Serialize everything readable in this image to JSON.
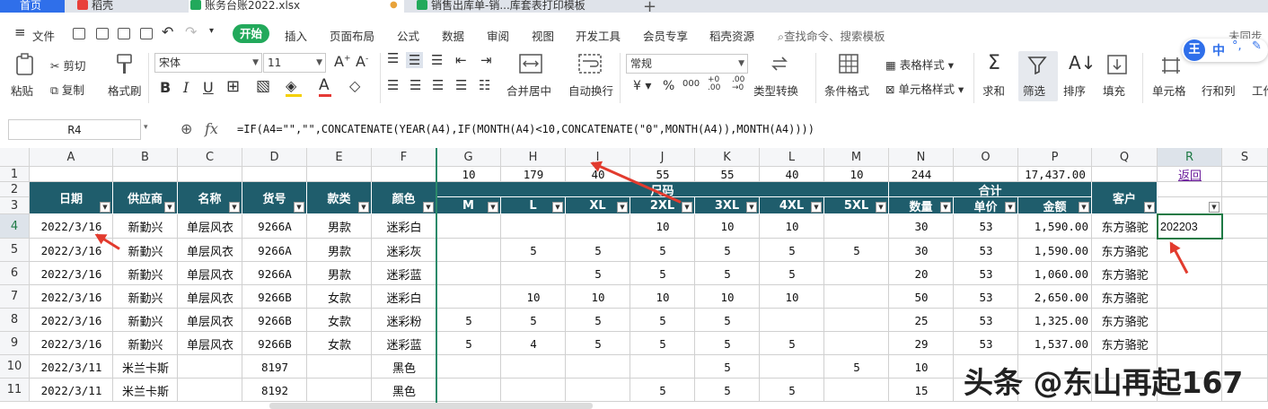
{
  "tabs": [
    {
      "label": "首页"
    },
    {
      "label": "稻壳"
    },
    {
      "label": "账务台账2022.xlsx"
    },
    {
      "label": "销售出库单-销...库套表打印模板"
    }
  ],
  "menu": {
    "file": "文件",
    "items": [
      "开始",
      "插入",
      "页面布局",
      "公式",
      "数据",
      "审阅",
      "视图",
      "开发工具",
      "会员专享",
      "稻壳资源"
    ],
    "search": "查找命令、搜索模板",
    "sync": "未同步"
  },
  "ribbon": {
    "paste": "粘贴",
    "cut": "剪切",
    "copy": "复制",
    "format_painter": "格式刷",
    "font_name": "宋体",
    "font_size": "11",
    "merge": "合并居中",
    "wrap": "自动换行",
    "number_format": "常规",
    "type_convert": "类型转换",
    "cond_format": "条件格式",
    "table_style": "表格样式",
    "cell_style": "单元格样式",
    "sum": "求和",
    "filter": "筛选",
    "sort": "排序",
    "fill": "填充",
    "cells": "单元格",
    "rows_cols": "行和列",
    "work": "工作"
  },
  "formula_bar": {
    "name_box": "R4",
    "fx": "fx",
    "formula": "=IF(A4=\"\",\"\",CONCATENATE(YEAR(A4),IF(MONTH(A4)<10,CONCATENATE(\"0\",MONTH(A4)),MONTH(A4))))"
  },
  "columns": [
    "A",
    "B",
    "C",
    "D",
    "E",
    "F",
    "G",
    "H",
    "I",
    "J",
    "K",
    "L",
    "M",
    "N",
    "O",
    "P",
    "Q",
    "R",
    "S"
  ],
  "row_numbers": [
    "1",
    "2",
    "3",
    "4",
    "5",
    "6",
    "7",
    "8",
    "9",
    "10",
    "11"
  ],
  "row1": {
    "G": "10",
    "H": "179",
    "I": "40",
    "J": "55",
    "K": "55",
    "L": "40",
    "M": "10",
    "N": "244",
    "P": "17,437.00",
    "R": "返回"
  },
  "headers": {
    "date": "日期",
    "supplier": "供应商",
    "name": "名称",
    "code": "货号",
    "style": "款类",
    "color": "颜色",
    "size_group": "尺码",
    "total_group": "合计",
    "customer": "客户",
    "sizes": [
      "M",
      "L",
      "XL",
      "2XL",
      "3XL",
      "4XL",
      "5XL"
    ],
    "qty": "数量",
    "price": "单价",
    "amount": "金额"
  },
  "rows": [
    {
      "A": "2022/3/16",
      "B": "新勤兴",
      "C": "单层风衣",
      "D": "9266A",
      "E": "男款",
      "F": "迷彩白",
      "G": "",
      "H": "",
      "I": "",
      "J": "10",
      "K": "10",
      "L": "10",
      "M": "",
      "N": "30",
      "O": "53",
      "P": "1,590.00",
      "Q": "东方骆驼",
      "R": "202203"
    },
    {
      "A": "2022/3/16",
      "B": "新勤兴",
      "C": "单层风衣",
      "D": "9266A",
      "E": "男款",
      "F": "迷彩灰",
      "G": "",
      "H": "5",
      "I": "5",
      "J": "5",
      "K": "5",
      "L": "5",
      "M": "5",
      "N": "30",
      "O": "53",
      "P": "1,590.00",
      "Q": "东方骆驼",
      "R": ""
    },
    {
      "A": "2022/3/16",
      "B": "新勤兴",
      "C": "单层风衣",
      "D": "9266A",
      "E": "男款",
      "F": "迷彩蓝",
      "G": "",
      "H": "",
      "I": "5",
      "J": "5",
      "K": "5",
      "L": "5",
      "M": "",
      "N": "20",
      "O": "53",
      "P": "1,060.00",
      "Q": "东方骆驼",
      "R": ""
    },
    {
      "A": "2022/3/16",
      "B": "新勤兴",
      "C": "单层风衣",
      "D": "9266B",
      "E": "女款",
      "F": "迷彩白",
      "G": "",
      "H": "10",
      "I": "10",
      "J": "10",
      "K": "10",
      "L": "10",
      "M": "",
      "N": "50",
      "O": "53",
      "P": "2,650.00",
      "Q": "东方骆驼",
      "R": ""
    },
    {
      "A": "2022/3/16",
      "B": "新勤兴",
      "C": "单层风衣",
      "D": "9266B",
      "E": "女款",
      "F": "迷彩粉",
      "G": "5",
      "H": "5",
      "I": "5",
      "J": "5",
      "K": "5",
      "L": "",
      "M": "",
      "N": "25",
      "O": "53",
      "P": "1,325.00",
      "Q": "东方骆驼",
      "R": ""
    },
    {
      "A": "2022/3/16",
      "B": "新勤兴",
      "C": "单层风衣",
      "D": "9266B",
      "E": "女款",
      "F": "迷彩蓝",
      "G": "5",
      "H": "4",
      "I": "5",
      "J": "5",
      "K": "5",
      "L": "5",
      "M": "",
      "N": "29",
      "O": "53",
      "P": "1,537.00",
      "Q": "东方骆驼",
      "R": ""
    },
    {
      "A": "2022/3/11",
      "B": "米兰卡斯",
      "C": "",
      "D": "8197",
      "E": "",
      "F": "黑色",
      "G": "",
      "H": "",
      "I": "",
      "J": "",
      "K": "5",
      "L": "",
      "M": "5",
      "N": "10",
      "O": "",
      "P": "",
      "Q": "",
      "R": ""
    },
    {
      "A": "2022/3/11",
      "B": "米兰卡斯",
      "C": "",
      "D": "8192",
      "E": "",
      "F": "黑色",
      "G": "",
      "H": "",
      "I": "",
      "J": "5",
      "K": "5",
      "L": "5",
      "M": "",
      "N": "15",
      "O": "",
      "P": "",
      "Q": "",
      "R": ""
    }
  ],
  "watermark": "头条 @东山再起167",
  "colors": {
    "header_bg": "#1f5d6c",
    "start_green": "#22a95b",
    "home_tab": "#2f6fea",
    "arrow": "#e23b2e",
    "selection": "#1e7a45"
  }
}
